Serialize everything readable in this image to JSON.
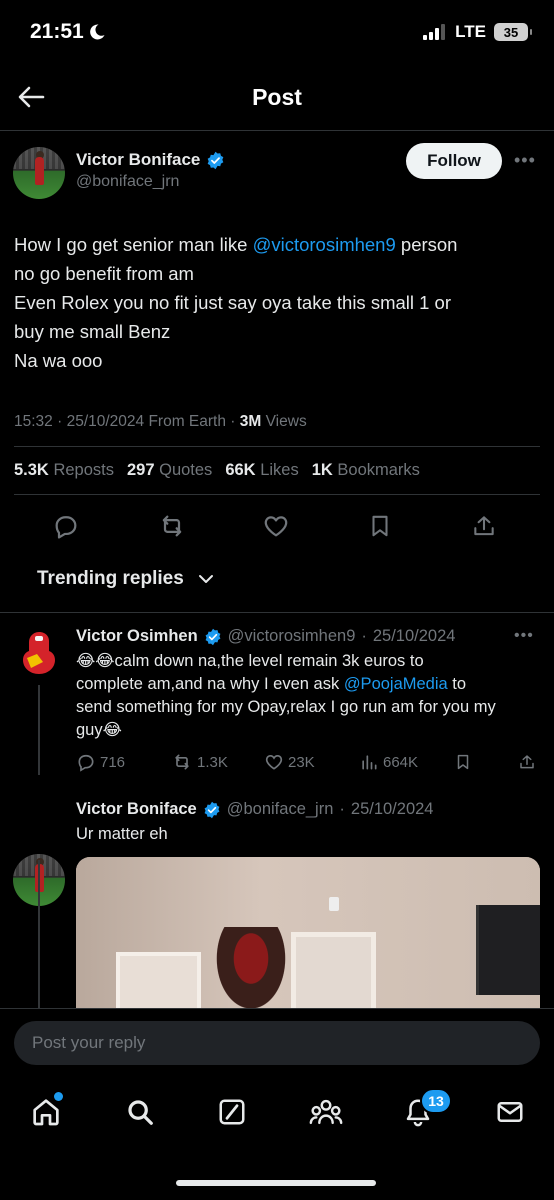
{
  "status_bar": {
    "time": "21:51",
    "network": "LTE",
    "battery": "35"
  },
  "header": {
    "title": "Post"
  },
  "post": {
    "author_name": "Victor Boniface",
    "author_handle": "@boniface_jrn",
    "follow_label": "Follow",
    "text_lines": [
      {
        "pre": "How I go get senior man like ",
        "mention": "@victorosimhen9",
        "post": " person"
      },
      {
        "pre": "no go benefit from am",
        "mention": "",
        "post": ""
      },
      {
        "pre": "Even Rolex you no fit just say oya take this small 1 or",
        "mention": "",
        "post": ""
      },
      {
        "pre": "buy me small Benz",
        "mention": "",
        "post": ""
      },
      {
        "pre": "Na wa ooo",
        "mention": "",
        "post": ""
      }
    ],
    "meta": {
      "time": "15:32",
      "date": "25/10/2024",
      "source": "From Earth",
      "views_count": "3M",
      "views_label": "Views"
    },
    "stats": {
      "reposts_count": "5.3K",
      "reposts_label": "Reposts",
      "quotes_count": "297",
      "quotes_label": "Quotes",
      "likes_count": "66K",
      "likes_label": "Likes",
      "bookmarks_count": "1K",
      "bookmarks_label": "Bookmarks"
    }
  },
  "trending": {
    "label": "Trending replies"
  },
  "replies": [
    {
      "author_name": "Victor Osimhen",
      "author_handle": "@victorosimhen9",
      "date": "25/10/2024",
      "lines": [
        {
          "pre": "😂😂calm down na,the level remain 3k euros to",
          "mention": "",
          "post": ""
        },
        {
          "pre": "complete am,and na why I even ask ",
          "mention": "@PoojaMedia",
          "post": " to"
        },
        {
          "pre": "send something for my Opay,relax I go run am for you my",
          "mention": "",
          "post": ""
        },
        {
          "pre": "guy😂",
          "mention": "",
          "post": ""
        }
      ],
      "replies_count": "716",
      "reposts_count": "1.3K",
      "likes_count": "23K",
      "views_count": "664K"
    },
    {
      "author_name": "Victor Boniface",
      "author_handle": "@boniface_jrn",
      "date": "25/10/2024",
      "text": "Ur matter eh"
    }
  ],
  "composer": {
    "placeholder": "Post your reply"
  },
  "tabbar": {
    "notifications_badge": "13"
  }
}
